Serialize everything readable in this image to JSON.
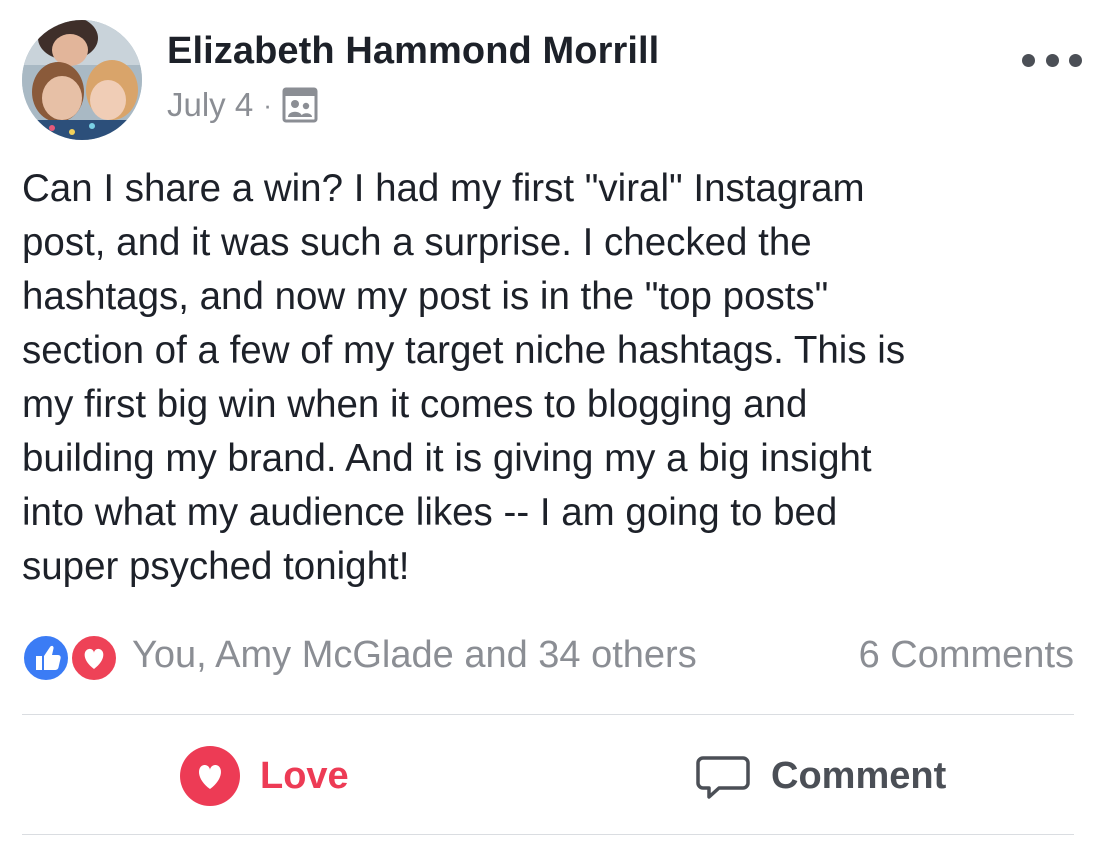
{
  "post": {
    "author": "Elizabeth Hammond Morrill",
    "date": "July 4",
    "separator": "·",
    "audience_icon": "group-icon",
    "more_icon": "more-icon",
    "text": "Can I share a win?  I had my first \"viral\" Instagram\npost, and it was such a surprise.  I checked the\nhashtags, and now my post is in the \"top posts\"\nsection of a few of my target niche hashtags.  This is\nmy first big win when it comes to blogging and\nbuilding my brand.  And it is giving my a big insight\ninto what my audience likes --  I am going to bed\nsuper psyched tonight!"
  },
  "reactions": {
    "icons": [
      "like-icon",
      "love-icon"
    ],
    "summary": "You, Amy McGlade and 34 others",
    "comments": "6 Comments"
  },
  "actions": {
    "love_label": "Love",
    "comment_label": "Comment"
  },
  "colors": {
    "love": "#ed3b55",
    "like": "#3b7cf5",
    "muted_text": "#8b8e94",
    "divider": "#dadde1"
  }
}
